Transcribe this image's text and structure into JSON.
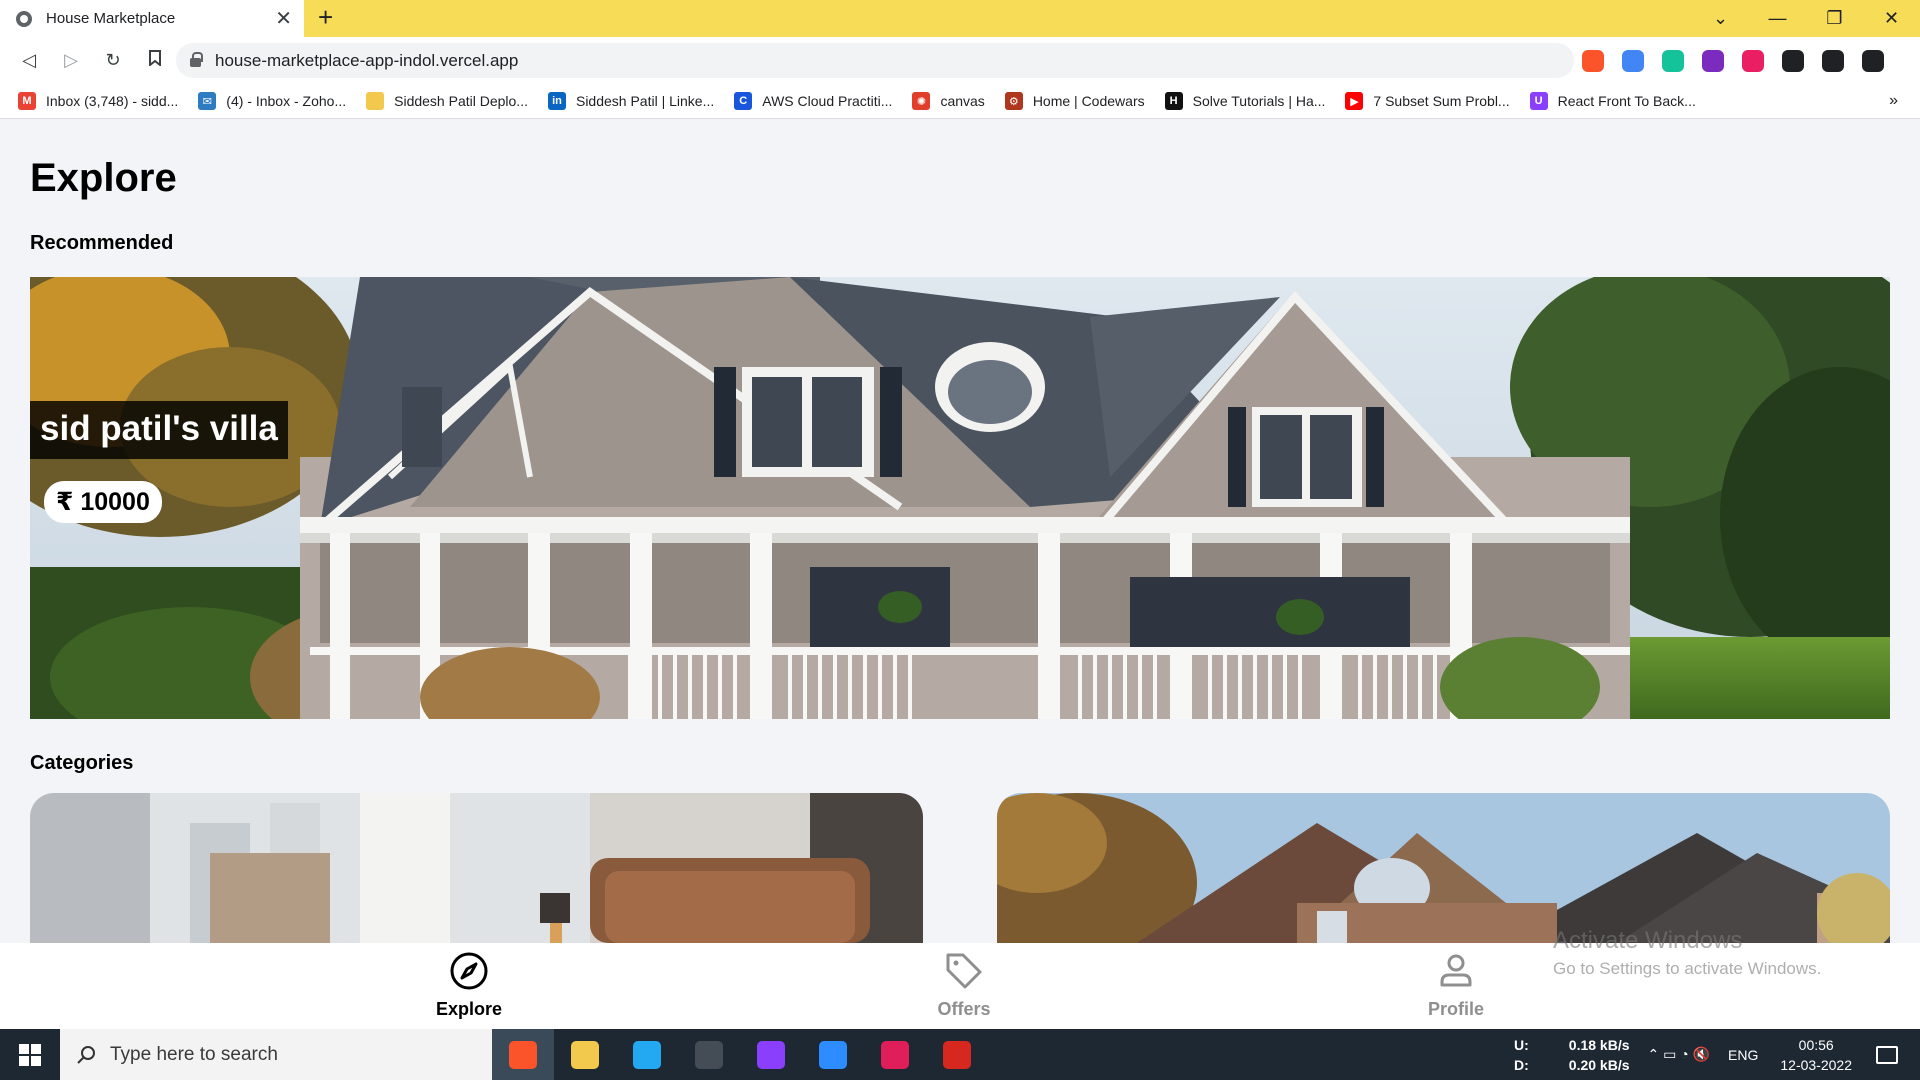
{
  "browser": {
    "tab_title": "House Marketplace",
    "tab_close": "✕",
    "new_tab": "+",
    "window_controls": [
      "⌄",
      "—",
      "❐",
      "✕"
    ],
    "url": "house-marketplace-app-indol.vercel.app",
    "nav": {
      "back": "◁",
      "forward": "▷",
      "reload": "↻",
      "bookmark": "🔖"
    },
    "bookmarks": [
      {
        "icon": "gmail-icon",
        "color": "#ea4335",
        "glyph": "M",
        "label": "Inbox (3,748) - sidd..."
      },
      {
        "icon": "zoho-mail-icon",
        "color": "#2d7cc1",
        "glyph": "✉",
        "label": "(4) - Inbox - Zoho..."
      },
      {
        "icon": "folder-icon",
        "color": "#f2c94c",
        "glyph": "",
        "label": "Siddesh Patil Deplo..."
      },
      {
        "icon": "linkedin-icon",
        "color": "#0a66c2",
        "glyph": "in",
        "label": "Siddesh Patil | Linke..."
      },
      {
        "icon": "aws-cloud-icon",
        "color": "#1a56db",
        "glyph": "C",
        "label": "AWS Cloud Practiti..."
      },
      {
        "icon": "canvas-icon",
        "color": "#e13f2b",
        "glyph": "✺",
        "label": "canvas"
      },
      {
        "icon": "codewars-icon",
        "color": "#b1361e",
        "glyph": "⚙",
        "label": "Home | Codewars"
      },
      {
        "icon": "hackerrank-icon",
        "color": "#111111",
        "glyph": "H",
        "label": "Solve Tutorials | Ha..."
      },
      {
        "icon": "youtube-icon",
        "color": "#ff0000",
        "glyph": "▶",
        "label": "7 Subset Sum Probl..."
      },
      {
        "icon": "udemy-icon",
        "color": "#8a3ffc",
        "glyph": "U",
        "label": "React Front To Back..."
      }
    ],
    "bookmarks_more": "»",
    "extensions": [
      {
        "name": "brave-shields-icon",
        "color": "#fb542b"
      },
      {
        "name": "translate-icon",
        "color": "#4285f4"
      },
      {
        "name": "grammarly-icon",
        "color": "#15c39a"
      },
      {
        "name": "screen-recorder-icon",
        "color": "#7b2cbf"
      },
      {
        "name": "color-picker-icon",
        "color": "#e91e63"
      },
      {
        "name": "puzzle-icon",
        "color": "#202124"
      },
      {
        "name": "wallet-icon",
        "color": "#202124"
      },
      {
        "name": "menu-icon",
        "color": "#202124"
      }
    ]
  },
  "page": {
    "title": "Explore",
    "recommended_heading": "Recommended",
    "slide": {
      "title": "sid patil's villa",
      "price": "₹ 10000"
    },
    "categories_heading": "Categories"
  },
  "bottom_nav": {
    "explore": "Explore",
    "offers": "Offers",
    "profile": "Profile"
  },
  "watermark": {
    "line1": "Activate Windows",
    "line2": "Go to Settings to activate Windows."
  },
  "taskbar": {
    "search_placeholder": "Type here to search",
    "apps": [
      {
        "name": "brave-browser-icon",
        "color": "#fb542b"
      },
      {
        "name": "file-explorer-icon",
        "color": "#f2c94c"
      },
      {
        "name": "vscode-icon",
        "color": "#23a9f2"
      },
      {
        "name": "terminal-icon",
        "color": "#444c56"
      },
      {
        "name": "github-desktop-icon",
        "color": "#8a3ffc"
      },
      {
        "name": "zoom-icon",
        "color": "#2d8cff"
      },
      {
        "name": "slack-icon",
        "color": "#e01e5a"
      },
      {
        "name": "acrobat-icon",
        "color": "#d6281f"
      }
    ],
    "net_up_label": "U:",
    "net_down_label": "D:",
    "net_up": "0.18 kB/s",
    "net_down": "0.20 kB/s",
    "tray_icons": "⌃  ▭  ◔  🔇",
    "language": "ENG",
    "time": "00:56",
    "date": "12-03-2022"
  }
}
